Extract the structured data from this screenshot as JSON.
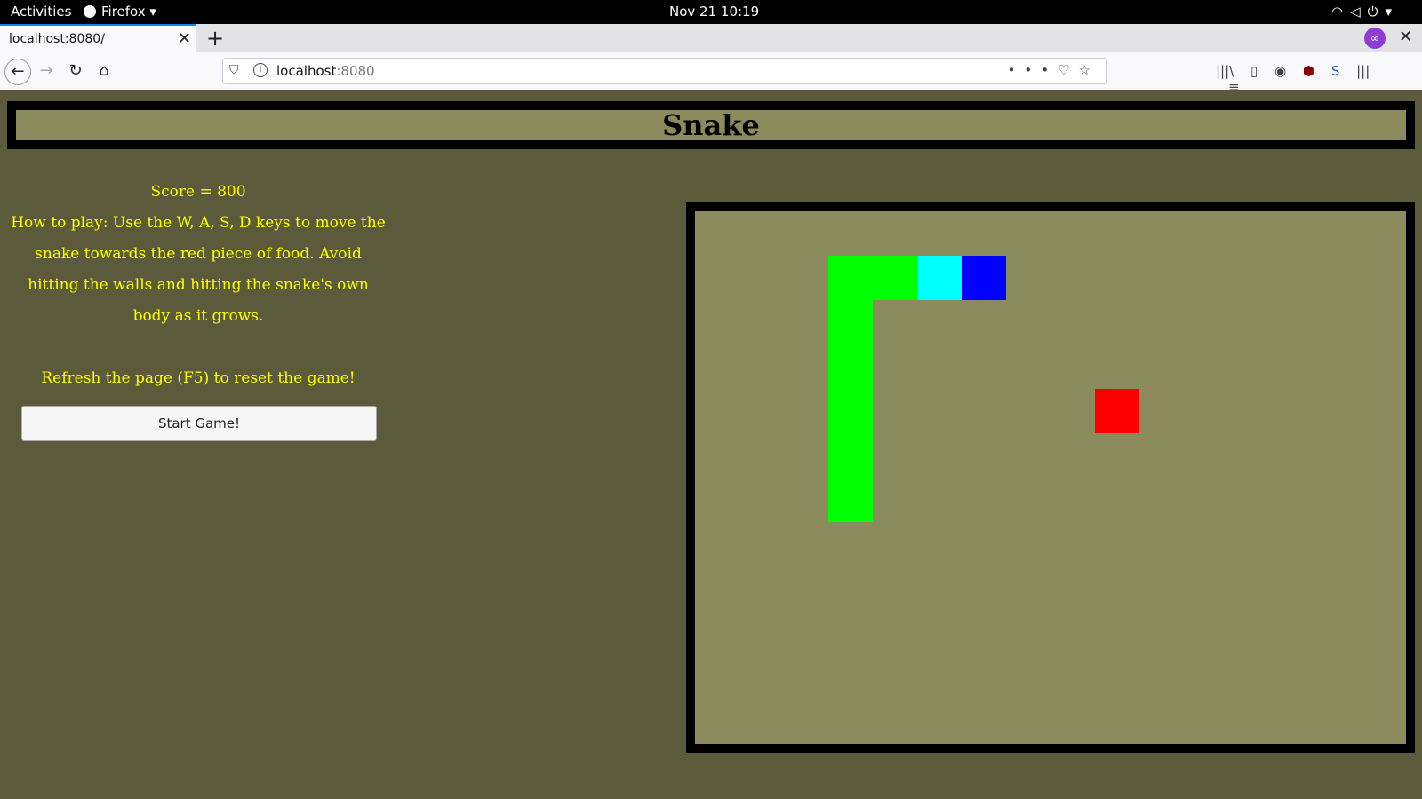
{
  "system_bar": {
    "activities": "Activities",
    "app_name": "Firefox",
    "datetime": "Nov 21  10:19"
  },
  "browser": {
    "tab_title": "localhost:8080/",
    "url_host": "localhost",
    "url_port": ":8080",
    "icons": [
      "back-icon",
      "forward-icon",
      "reload-icon",
      "home-icon",
      "shield-icon",
      "info-icon",
      "more-icon",
      "pocket-icon",
      "bookmark-star-icon",
      "library-icon",
      "sidebar-icon",
      "account-icon",
      "ublock-icon",
      "extension-icon",
      "menu-icon"
    ]
  },
  "page": {
    "title": "Snake",
    "score_text": "Score = 800",
    "instructions": "How to play: Use the W, A, S, D keys to move the snake towards the red piece of food. Avoid hitting the walls and hitting the snake's own body as it grows.",
    "reset_hint": "Refresh the page (F5) to reset the game!",
    "start_button": "Start Game!"
  },
  "game": {
    "grid_cols": 16,
    "grid_rows": 12,
    "colors": {
      "body": "#00ff00",
      "neck": "#00ffff",
      "head": "#0000ff",
      "food": "#ff0000",
      "board": "#8b8b5e",
      "background": "#5b5b3c"
    },
    "snake": [
      {
        "col": 3,
        "row": 1,
        "part": "body"
      },
      {
        "col": 4,
        "row": 1,
        "part": "body"
      },
      {
        "col": 5,
        "row": 1,
        "part": "neck"
      },
      {
        "col": 6,
        "row": 1,
        "part": "head"
      },
      {
        "col": 3,
        "row": 2,
        "part": "body"
      },
      {
        "col": 3,
        "row": 3,
        "part": "body"
      },
      {
        "col": 3,
        "row": 4,
        "part": "body"
      },
      {
        "col": 3,
        "row": 5,
        "part": "body"
      },
      {
        "col": 3,
        "row": 6,
        "part": "body"
      }
    ],
    "food": {
      "col": 9,
      "row": 4
    }
  }
}
